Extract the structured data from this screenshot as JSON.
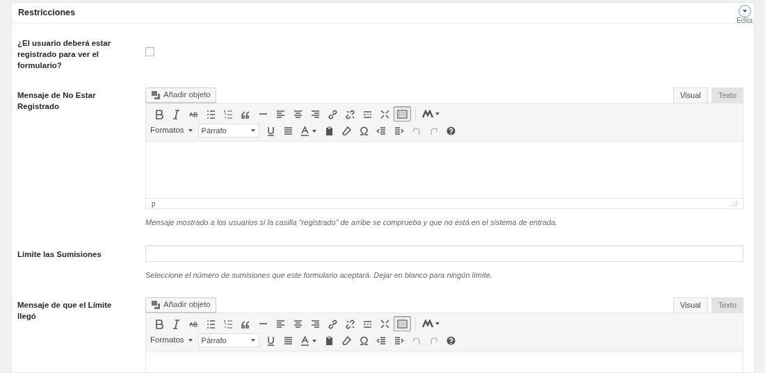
{
  "panel": {
    "title": "Restricciones",
    "toggle_label": "Edita"
  },
  "fields": [
    {
      "kind": "checkbox",
      "label": "¿El usuario deberá estar registrado para ver el formulario?",
      "checked": false
    },
    {
      "kind": "editor",
      "label": "Mensaje de No Estar Registrado",
      "add_media": "Añadir objeto",
      "tabs": [
        {
          "label": "Visual",
          "selected": true
        },
        {
          "label": "Texto",
          "selected": false
        }
      ],
      "formats": "Formatos",
      "block_format": "Párrafo",
      "toolbar_toggle_pressed": true,
      "path": "p",
      "description": "Mensaje mostrado a los usuarios si la casilla \"registrado\" de arribe se comprueba y que no está en el sistema de entrada."
    },
    {
      "kind": "text",
      "label": "Limite las Sumisiones",
      "description": "Seleccione el número de sumisiones que este formulario aceptará. Dejar en blanco para ningún límite."
    },
    {
      "kind": "editor",
      "label": "Mensaje de que el Límite llegó",
      "add_media": "Añadir objeto",
      "tabs": [
        {
          "label": "Visual",
          "selected": true
        },
        {
          "label": "Texto",
          "selected": false
        }
      ],
      "formats": "Formatos",
      "block_format": "Párrafo",
      "toolbar_toggle_pressed": true
    }
  ]
}
